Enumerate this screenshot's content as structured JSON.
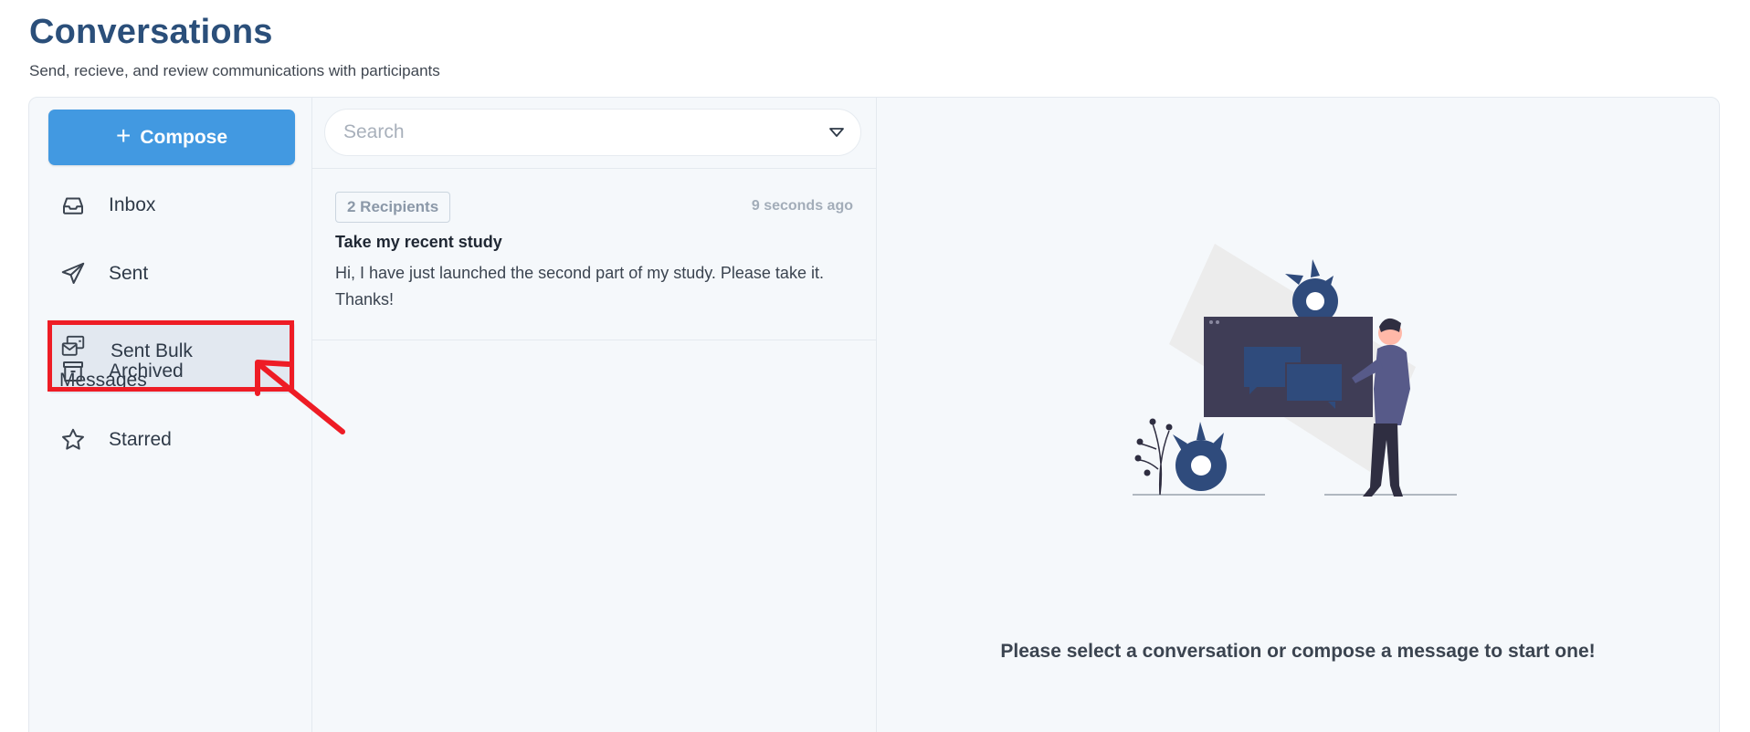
{
  "header": {
    "title": "Conversations",
    "subtitle": "Send, recieve, and review communications with participants"
  },
  "sidebar": {
    "compose_label": "Compose",
    "items": [
      {
        "label": "Inbox",
        "icon": "inbox-icon"
      },
      {
        "label": "Sent",
        "icon": "paper-plane-icon"
      },
      {
        "label": "Sent Bulk Messages",
        "icon": "bulk-mail-icon",
        "active": true
      },
      {
        "label": "Archived",
        "icon": "archive-box-icon"
      },
      {
        "label": "Starred",
        "icon": "star-icon"
      }
    ]
  },
  "search": {
    "placeholder": "Search",
    "value": ""
  },
  "conversations": [
    {
      "recipients": "2 Recipients",
      "time": "9 seconds ago",
      "subject": "Take my recent study",
      "preview": "Hi, I have just launched the second part of my study. Please take it. Thanks!"
    }
  ],
  "detail": {
    "empty_message": "Please select a conversation or compose a message to start one!"
  },
  "colors": {
    "title": "#2b4f7a",
    "compose": "#4299e1",
    "highlight": "#ee1c25",
    "illustration_dark": "#3f3d56",
    "illustration_accent": "#2f4b7c"
  }
}
